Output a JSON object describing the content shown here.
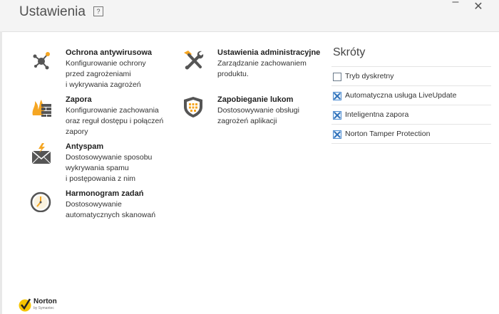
{
  "window": {
    "title": "Ustawienia",
    "help": "?",
    "minimize": "–",
    "close": "✕"
  },
  "settings": [
    {
      "id": "ochrona",
      "title": "Ochrona antywirusowa",
      "desc": "Konfigurowanie ochrony\nprzed zagrożeniami\ni wykrywania zagrożeń",
      "icon": "virus-network-icon"
    },
    {
      "id": "zapora",
      "title": "Zapora",
      "desc": "Konfigurowanie zachowania\noraz reguł dostępu i połączeń\nzapory",
      "icon": "firewall-icon"
    },
    {
      "id": "antyspam",
      "title": "Antyspam",
      "desc": "Dostosowywanie sposobu\nwykrywania spamu\ni postępowania z nim",
      "icon": "spam-envelope-icon"
    },
    {
      "id": "harmonogram",
      "title": "Harmonogram zadań",
      "desc": "Dostosowywanie\nautomatycznych skanowań",
      "icon": "clock-icon"
    },
    {
      "id": "admin",
      "title": "Ustawienia administracyjne",
      "desc": "Zarządzanie zachowaniem\nproduktu.",
      "icon": "tools-icon"
    },
    {
      "id": "zapobieganie",
      "title": "Zapobieganie lukom",
      "desc": "Dostosowywanie obsługi\nzagrożeń aplikacji",
      "icon": "shield-icon"
    }
  ],
  "shortcuts": {
    "title": "Skróty",
    "items": [
      {
        "label": "Tryb dyskretny",
        "checked": false
      },
      {
        "label": "Automatyczna usługa LiveUpdate",
        "checked": true
      },
      {
        "label": "Inteligentna zapora",
        "checked": true
      },
      {
        "label": "Norton Tamper Protection",
        "checked": true
      }
    ]
  },
  "logo": {
    "name": "Norton",
    "sub": "by Symantec"
  },
  "colors": {
    "accent": "#f5a623",
    "checkbox": "#2d6fb8",
    "icon": "#555555"
  }
}
